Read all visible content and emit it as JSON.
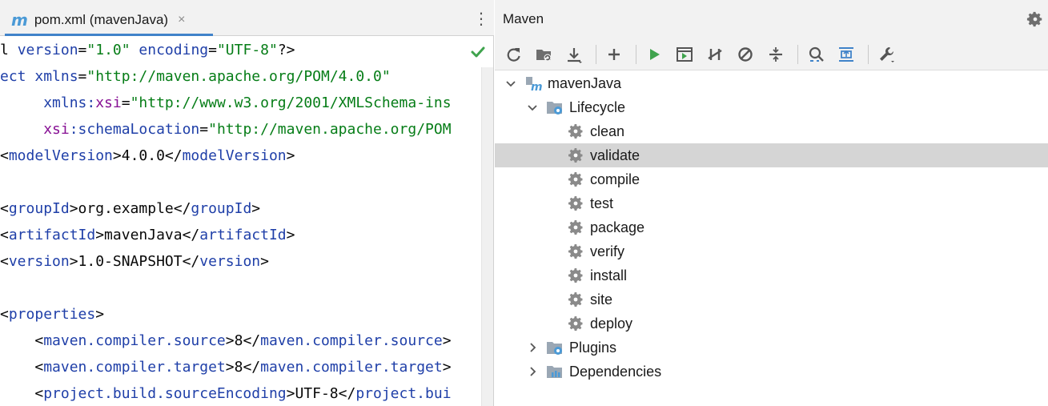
{
  "editor": {
    "tab": {
      "label": "pom.xml (mavenJava)",
      "icon": "maven-file-icon",
      "close": "×"
    },
    "menu_glyph": "⋮",
    "status_icon": "check-icon",
    "lines": [
      {
        "parts": [
          {
            "t": "l ",
            "c": "txt"
          },
          {
            "t": "version",
            "c": "attr"
          },
          {
            "t": "=",
            "c": "txt"
          },
          {
            "t": "\"1.0\"",
            "c": "str"
          },
          {
            "t": " ",
            "c": "txt"
          },
          {
            "t": "encoding",
            "c": "attr"
          },
          {
            "t": "=",
            "c": "txt"
          },
          {
            "t": "\"UTF-8\"",
            "c": "str"
          },
          {
            "t": "?>",
            "c": "txt"
          }
        ]
      },
      {
        "parts": [
          {
            "t": "ect ",
            "c": "tag"
          },
          {
            "t": "xmlns",
            "c": "attr"
          },
          {
            "t": "=",
            "c": "txt"
          },
          {
            "t": "\"http://maven.apache.org/POM/4.0.0\"",
            "c": "str"
          }
        ]
      },
      {
        "parts": [
          {
            "t": "     ",
            "c": "txt"
          },
          {
            "t": "xmlns:",
            "c": "attr"
          },
          {
            "t": "xsi",
            "c": "ns"
          },
          {
            "t": "=",
            "c": "txt"
          },
          {
            "t": "\"http://www.w3.org/2001/XMLSchema-ins",
            "c": "str"
          }
        ]
      },
      {
        "parts": [
          {
            "t": "     ",
            "c": "txt"
          },
          {
            "t": "xsi",
            "c": "ns"
          },
          {
            "t": ":schemaLocation",
            "c": "attr"
          },
          {
            "t": "=",
            "c": "txt"
          },
          {
            "t": "\"http://maven.apache.org/POM",
            "c": "str"
          }
        ]
      },
      {
        "parts": [
          {
            "t": "<",
            "c": "txt"
          },
          {
            "t": "modelVersion",
            "c": "tag"
          },
          {
            "t": ">4.0.0</",
            "c": "txt"
          },
          {
            "t": "modelVersion",
            "c": "tag"
          },
          {
            "t": ">",
            "c": "txt"
          }
        ]
      },
      {
        "parts": []
      },
      {
        "parts": [
          {
            "t": "<",
            "c": "txt"
          },
          {
            "t": "groupId",
            "c": "tag"
          },
          {
            "t": ">org.example</",
            "c": "txt"
          },
          {
            "t": "groupId",
            "c": "tag"
          },
          {
            "t": ">",
            "c": "txt"
          }
        ]
      },
      {
        "parts": [
          {
            "t": "<",
            "c": "txt"
          },
          {
            "t": "artifactId",
            "c": "tag"
          },
          {
            "t": ">mavenJava</",
            "c": "txt"
          },
          {
            "t": "artifactId",
            "c": "tag"
          },
          {
            "t": ">",
            "c": "txt"
          }
        ]
      },
      {
        "parts": [
          {
            "t": "<",
            "c": "txt"
          },
          {
            "t": "version",
            "c": "tag"
          },
          {
            "t": ">1.0-SNAPSHOT</",
            "c": "txt"
          },
          {
            "t": "version",
            "c": "tag"
          },
          {
            "t": ">",
            "c": "txt"
          }
        ]
      },
      {
        "parts": []
      },
      {
        "parts": [
          {
            "t": "<",
            "c": "txt"
          },
          {
            "t": "properties",
            "c": "tag"
          },
          {
            "t": ">",
            "c": "txt"
          }
        ]
      },
      {
        "parts": [
          {
            "t": "    <",
            "c": "txt"
          },
          {
            "t": "maven.compiler.source",
            "c": "tag"
          },
          {
            "t": ">8</",
            "c": "txt"
          },
          {
            "t": "maven.compiler.source",
            "c": "tag"
          },
          {
            "t": ">",
            "c": "txt"
          }
        ]
      },
      {
        "parts": [
          {
            "t": "    <",
            "c": "txt"
          },
          {
            "t": "maven.compiler.target",
            "c": "tag"
          },
          {
            "t": ">8</",
            "c": "txt"
          },
          {
            "t": "maven.compiler.target",
            "c": "tag"
          },
          {
            "t": ">",
            "c": "txt"
          }
        ]
      },
      {
        "parts": [
          {
            "t": "    <",
            "c": "txt"
          },
          {
            "t": "project.build.sourceEncoding",
            "c": "tag"
          },
          {
            "t": ">UTF-8</",
            "c": "txt"
          },
          {
            "t": "project.bui",
            "c": "tag"
          }
        ]
      }
    ]
  },
  "maven": {
    "title": "Maven",
    "settings_icon": "gear-icon",
    "toolbar": [
      {
        "name": "reload-icon"
      },
      {
        "name": "add-folder-icon"
      },
      {
        "name": "download-icon"
      },
      {
        "sep": true
      },
      {
        "name": "plus-icon"
      },
      {
        "sep": true
      },
      {
        "name": "run-icon"
      },
      {
        "name": "execute-goal-icon"
      },
      {
        "name": "toggle-offline-icon"
      },
      {
        "name": "skip-tests-icon"
      },
      {
        "name": "collapse-icon"
      },
      {
        "sep": true
      },
      {
        "name": "analyze-dependencies-icon"
      },
      {
        "name": "show-diagram-icon"
      },
      {
        "sep": true
      },
      {
        "name": "wrench-icon"
      }
    ],
    "tree": [
      {
        "label": "mavenJava",
        "level": 0,
        "expanded": true,
        "icon": "maven-project-icon"
      },
      {
        "label": "Lifecycle",
        "level": 1,
        "expanded": true,
        "icon": "lifecycle-folder-icon"
      },
      {
        "label": "clean",
        "level": 2,
        "icon": "goal-gear-icon"
      },
      {
        "label": "validate",
        "level": 2,
        "icon": "goal-gear-icon",
        "selected": true
      },
      {
        "label": "compile",
        "level": 2,
        "icon": "goal-gear-icon"
      },
      {
        "label": "test",
        "level": 2,
        "icon": "goal-gear-icon"
      },
      {
        "label": "package",
        "level": 2,
        "icon": "goal-gear-icon"
      },
      {
        "label": "verify",
        "level": 2,
        "icon": "goal-gear-icon"
      },
      {
        "label": "install",
        "level": 2,
        "icon": "goal-gear-icon"
      },
      {
        "label": "site",
        "level": 2,
        "icon": "goal-gear-icon"
      },
      {
        "label": "deploy",
        "level": 2,
        "icon": "goal-gear-icon"
      },
      {
        "label": "Plugins",
        "level": 1,
        "expanded": false,
        "icon": "plugins-folder-icon"
      },
      {
        "label": "Dependencies",
        "level": 1,
        "expanded": false,
        "icon": "dependencies-icon"
      }
    ]
  },
  "colors": {
    "accent": "#4083c9",
    "run_green": "#3fa34d",
    "selection": "#d5d5d5"
  }
}
